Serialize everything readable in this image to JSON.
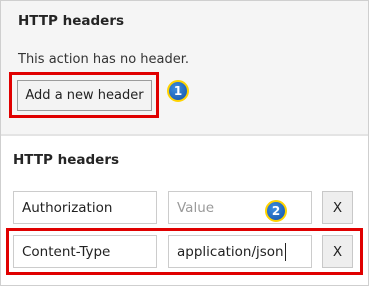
{
  "section1": {
    "title": "HTTP headers",
    "empty_message": "This action has no header.",
    "add_button_label": "Add a new header"
  },
  "section2": {
    "title": "HTTP headers",
    "rows": [
      {
        "key": "Authorization",
        "value": "",
        "value_placeholder": "Value",
        "remove_label": "X"
      },
      {
        "key": "Content-Type",
        "value": "application/json",
        "remove_label": "X"
      }
    ]
  },
  "annotations": {
    "badge1": "1",
    "badge2": "2",
    "highlight_color": "#e00000",
    "badge_color": "#1f63b8",
    "badge_border": "#ffd300"
  }
}
